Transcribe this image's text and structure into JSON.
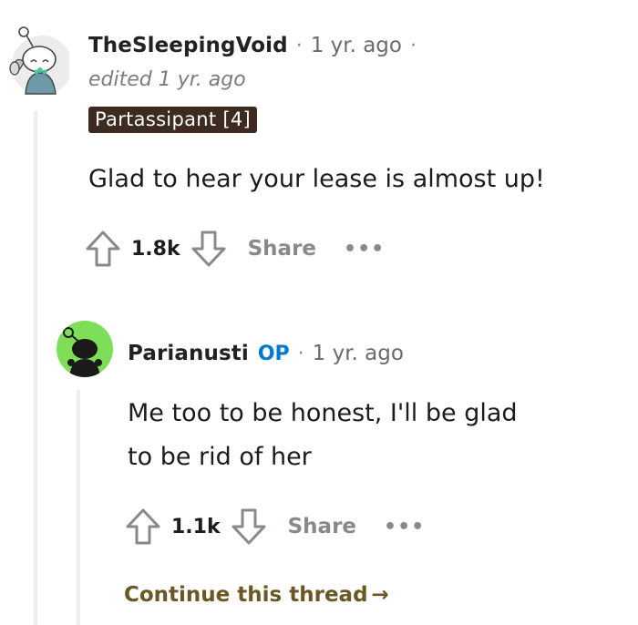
{
  "comment1": {
    "username": "TheSleepingVoid",
    "time": "1 yr. ago",
    "edited": "edited 1 yr. ago",
    "flair": "Partassipant [4]",
    "body": "Glad to hear your lease is almost up!",
    "votes": "1.8k",
    "share_label": "Share",
    "more_label": "•••",
    "dot": "·"
  },
  "comment2": {
    "username": "Parianusti",
    "op_badge": "OP",
    "time": "1 yr. ago",
    "body_line1": "Me too to be honest, I'll be glad",
    "body_line2": "to be rid of her",
    "votes": "1.1k",
    "share_label": "Share",
    "more_label": "•••",
    "dot": "·"
  },
  "continue_thread": {
    "label": "Continue this thread",
    "arrow": "→"
  },
  "colors": {
    "upvote_icon": "#878a8c",
    "flair_bg": "#3d2b20",
    "op_blue": "#0079d3",
    "continue_text": "#6b5724",
    "avatar2_bg": "#7ede58"
  }
}
